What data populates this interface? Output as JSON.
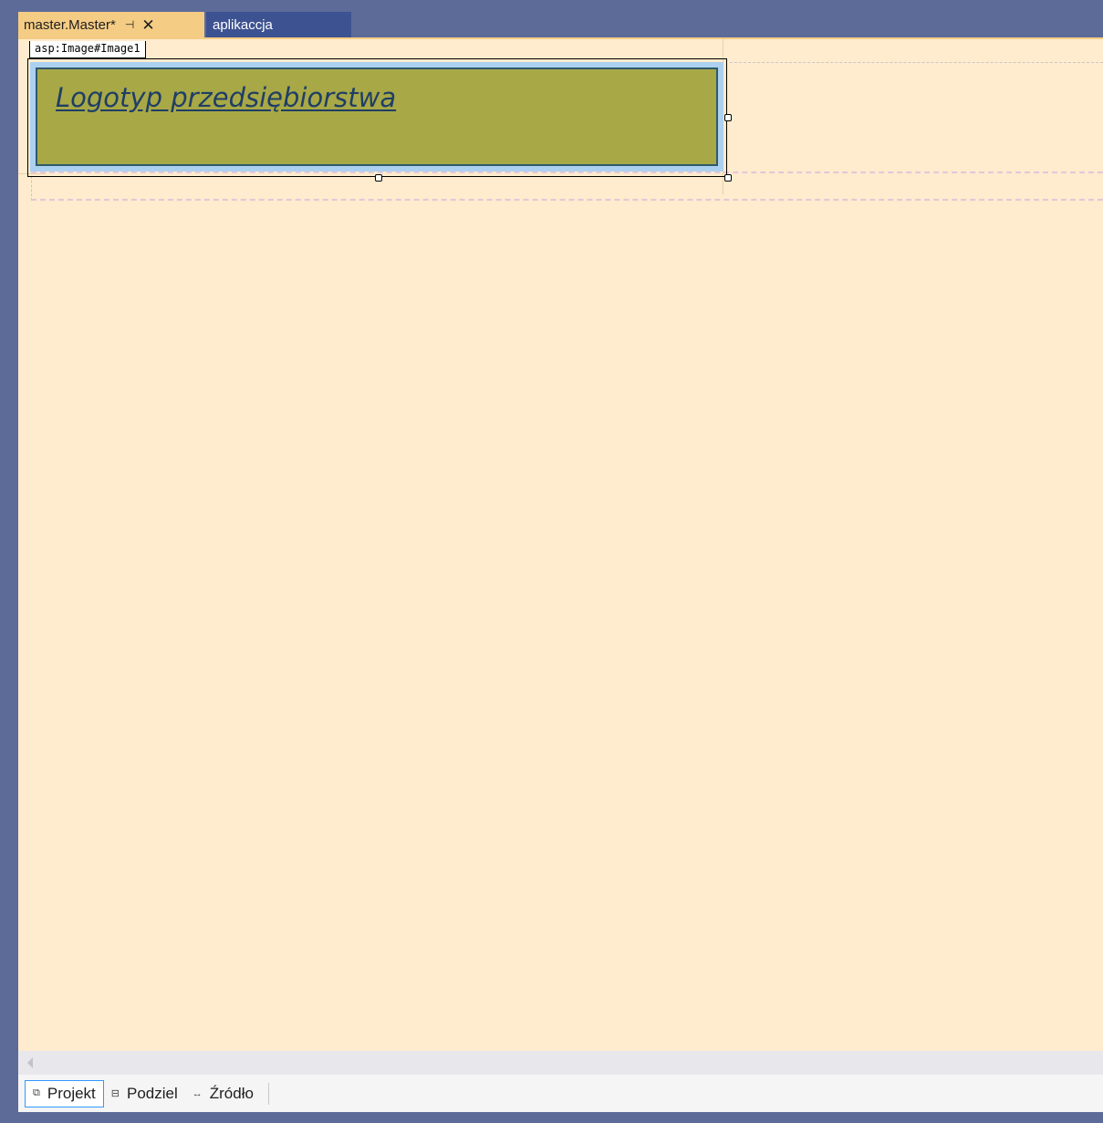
{
  "tabs": {
    "active": {
      "title": "master.Master*",
      "pin_icon": "pin-icon",
      "close_icon": "close-icon"
    },
    "inactive": {
      "title": "aplikaccja"
    }
  },
  "designer": {
    "selected_tag": "asp:Image#Image1",
    "logo_text": "Logotyp przedsiębiorstwa"
  },
  "view_tabs": [
    {
      "label": "Projekt",
      "icon": "design-view-icon",
      "active": true
    },
    {
      "label": "Podziel",
      "icon": "split-view-icon",
      "active": false
    },
    {
      "label": "Źródło",
      "icon": "source-view-icon",
      "active": false
    }
  ],
  "colors": {
    "chrome": "#5d6b99",
    "active_tab": "#f5cc84",
    "inactive_tab": "#3d5291",
    "design_surface": "#ffebcd",
    "logo_fill": "#a8a846",
    "logo_frame": "#acd0f0"
  }
}
